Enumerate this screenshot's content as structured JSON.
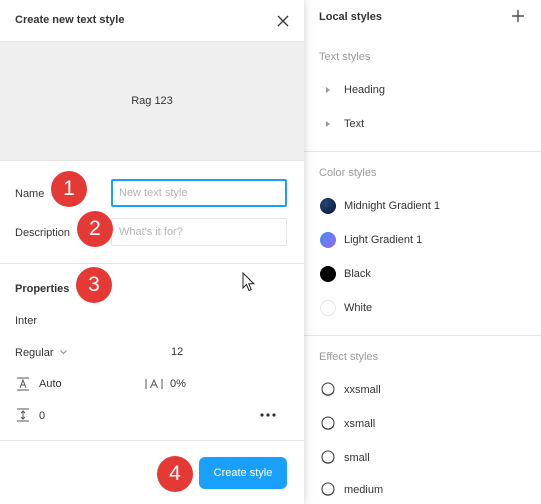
{
  "dialog": {
    "title": "Create new text style",
    "preview_text": "Rag 123",
    "name_label": "Name",
    "name_placeholder": "New text style",
    "name_value": "",
    "description_label": "Description",
    "description_placeholder": "What's it for?",
    "description_value": "",
    "properties_title": "Properties",
    "font_family": "Inter",
    "font_weight": "Regular",
    "font_size": "12",
    "line_height": "Auto",
    "letter_spacing": "0%",
    "paragraph_spacing": "0",
    "create_button": "Create style"
  },
  "badges": [
    "1",
    "2",
    "3",
    "4"
  ],
  "panel": {
    "title": "Local styles",
    "text_styles_title": "Text styles",
    "text_styles": [
      {
        "label": "Heading"
      },
      {
        "label": "Text"
      }
    ],
    "color_styles_title": "Color styles",
    "color_styles": [
      {
        "label": "Midnight Gradient 1",
        "color_from": "#0b1a3a",
        "color_to": "#1c3d6e"
      },
      {
        "label": "Light Gradient 1",
        "color_from": "#4a7ff0",
        "color_to": "#8a6cf5"
      },
      {
        "label": "Black",
        "color_from": "#000000",
        "color_to": "#000000"
      },
      {
        "label": "White",
        "color_from": "#ffffff",
        "color_to": "#ffffff"
      }
    ],
    "effect_styles_title": "Effect styles",
    "effect_styles": [
      {
        "label": "xxsmall"
      },
      {
        "label": "xsmall"
      },
      {
        "label": "small"
      },
      {
        "label": "medium"
      }
    ]
  },
  "colors": {
    "accent": "#18a0fb",
    "badge": "#e53935",
    "preview_bg": "#efefef"
  }
}
